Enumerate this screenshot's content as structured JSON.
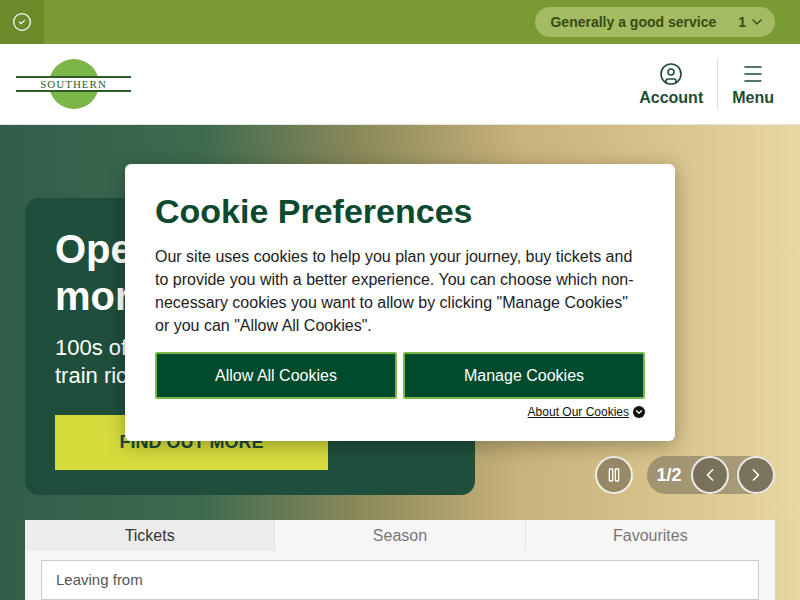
{
  "status_bar": {
    "message": "Generally a good service",
    "count": "1"
  },
  "header": {
    "logo": "SOUTHERN",
    "actions": [
      {
        "label": "Account",
        "kind": "account"
      },
      {
        "label": "Menu",
        "kind": "menu"
      }
    ]
  },
  "hero": {
    "heading": [
      "Ope",
      "mor"
    ],
    "body": [
      "100s of",
      "train ric"
    ],
    "button": "FIND OUT MORE",
    "slide": "1/2"
  },
  "booking": {
    "tabs": [
      {
        "label": "Tickets",
        "selected": true
      },
      {
        "label": "Season",
        "selected": false
      },
      {
        "label": "Favourites",
        "selected": false
      }
    ],
    "field": {
      "placeholder": "Leaving from"
    }
  },
  "cookie_dialog": {
    "title": "Cookie Preferences",
    "text": "Our site uses cookies to help you plan your journey, buy tickets and to provide you with a better experience. You can choose which non-necessary cookies you want to allow by clicking \"Manage Cookies\" or you can \"Allow All Cookies\".",
    "buttons": [
      "Allow All Cookies",
      "Manage Cookies"
    ],
    "link": "About Our Cookies"
  }
}
